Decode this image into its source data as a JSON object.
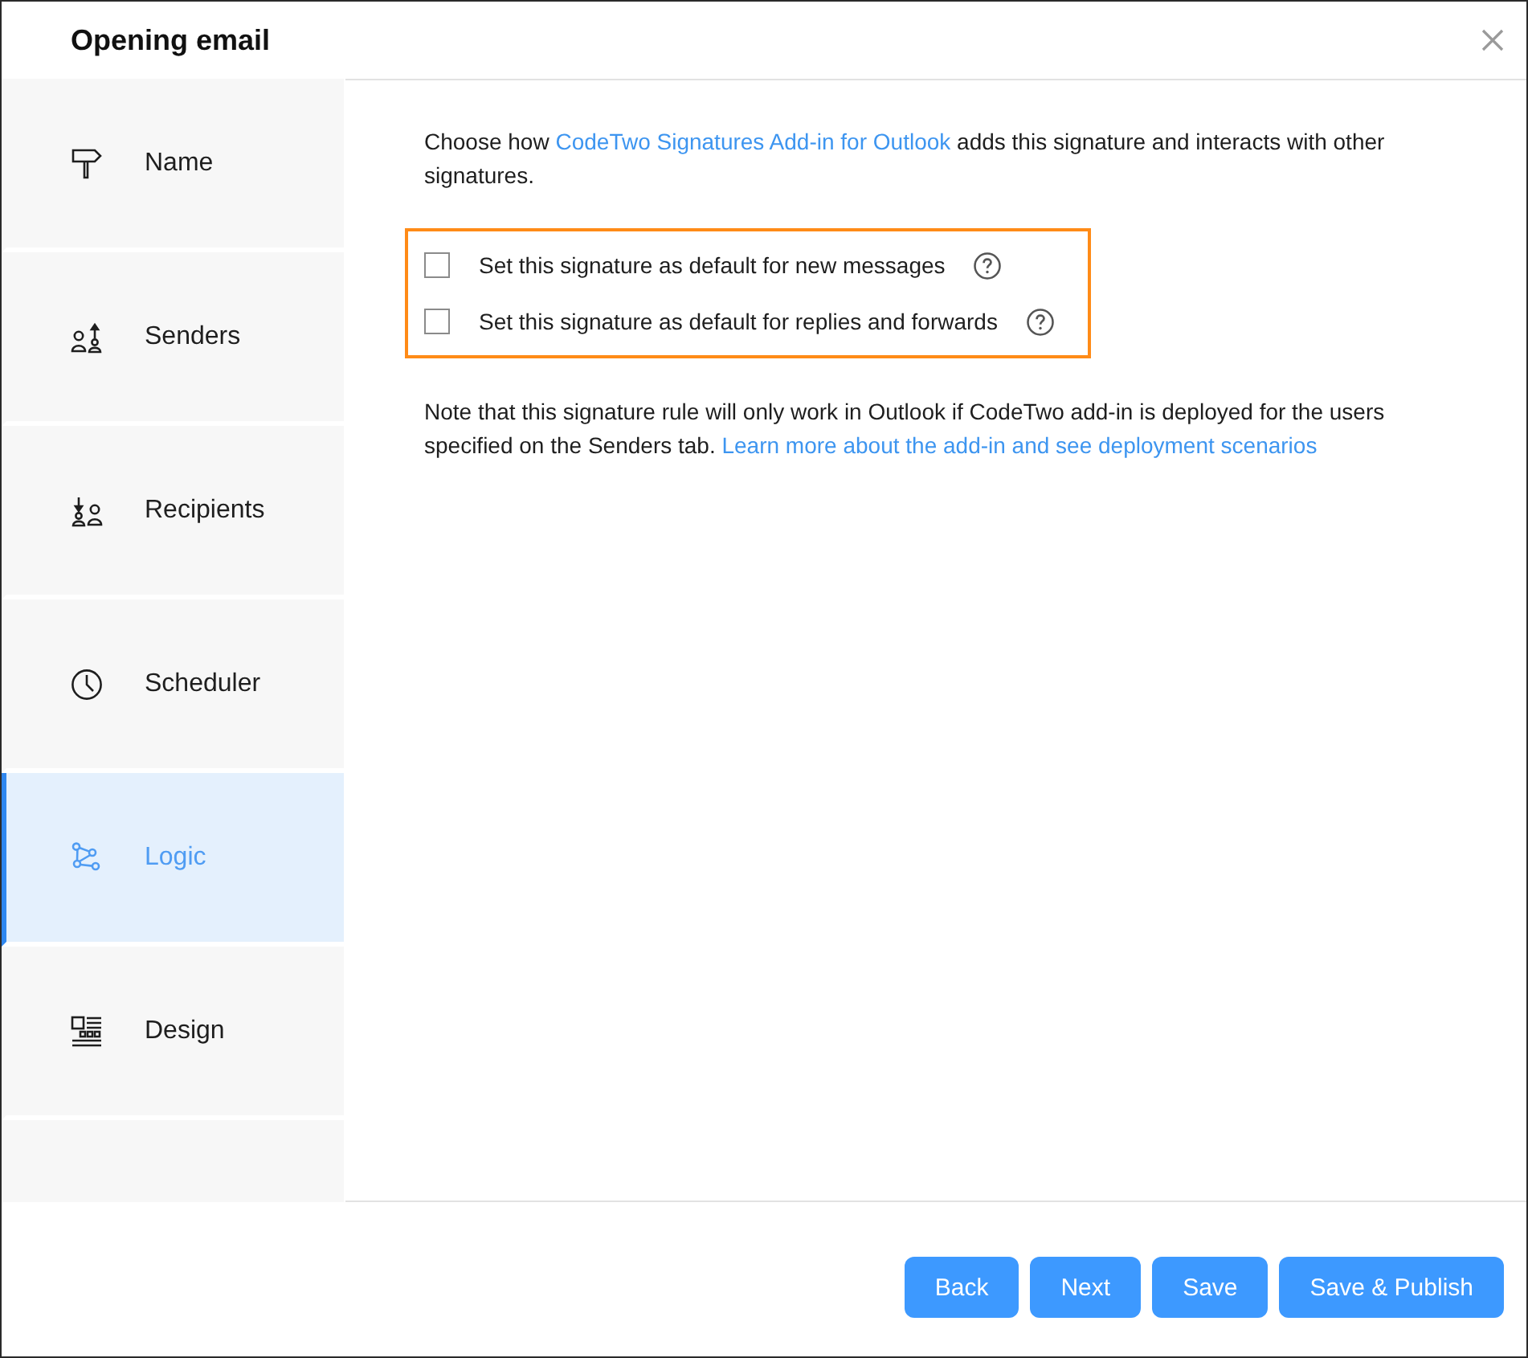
{
  "window": {
    "title": "Opening email"
  },
  "sidebar": {
    "items": [
      {
        "label": "Name",
        "selected": false
      },
      {
        "label": "Senders",
        "selected": false
      },
      {
        "label": "Recipients",
        "selected": false
      },
      {
        "label": "Scheduler",
        "selected": false
      },
      {
        "label": "Logic",
        "selected": true
      },
      {
        "label": "Design",
        "selected": false
      }
    ]
  },
  "intro": {
    "before": "Choose how ",
    "link": "CodeTwo Signatures Add-in for Outlook",
    "after": " adds this signature and interacts with other signatures."
  },
  "options": {
    "highlighted": true,
    "items": [
      {
        "label": "Set this signature as default for new messages",
        "checked": false
      },
      {
        "label": "Set this signature as default for replies and forwards",
        "checked": false
      }
    ]
  },
  "note": {
    "text": "Note that this signature rule will only work in Outlook if CodeTwo add-in is deployed for the users specified on the Senders tab. ",
    "link": "Learn more about the add-in and see deployment scenarios"
  },
  "buttons": [
    "Back",
    "Next",
    "Save",
    "Save & Publish"
  ]
}
